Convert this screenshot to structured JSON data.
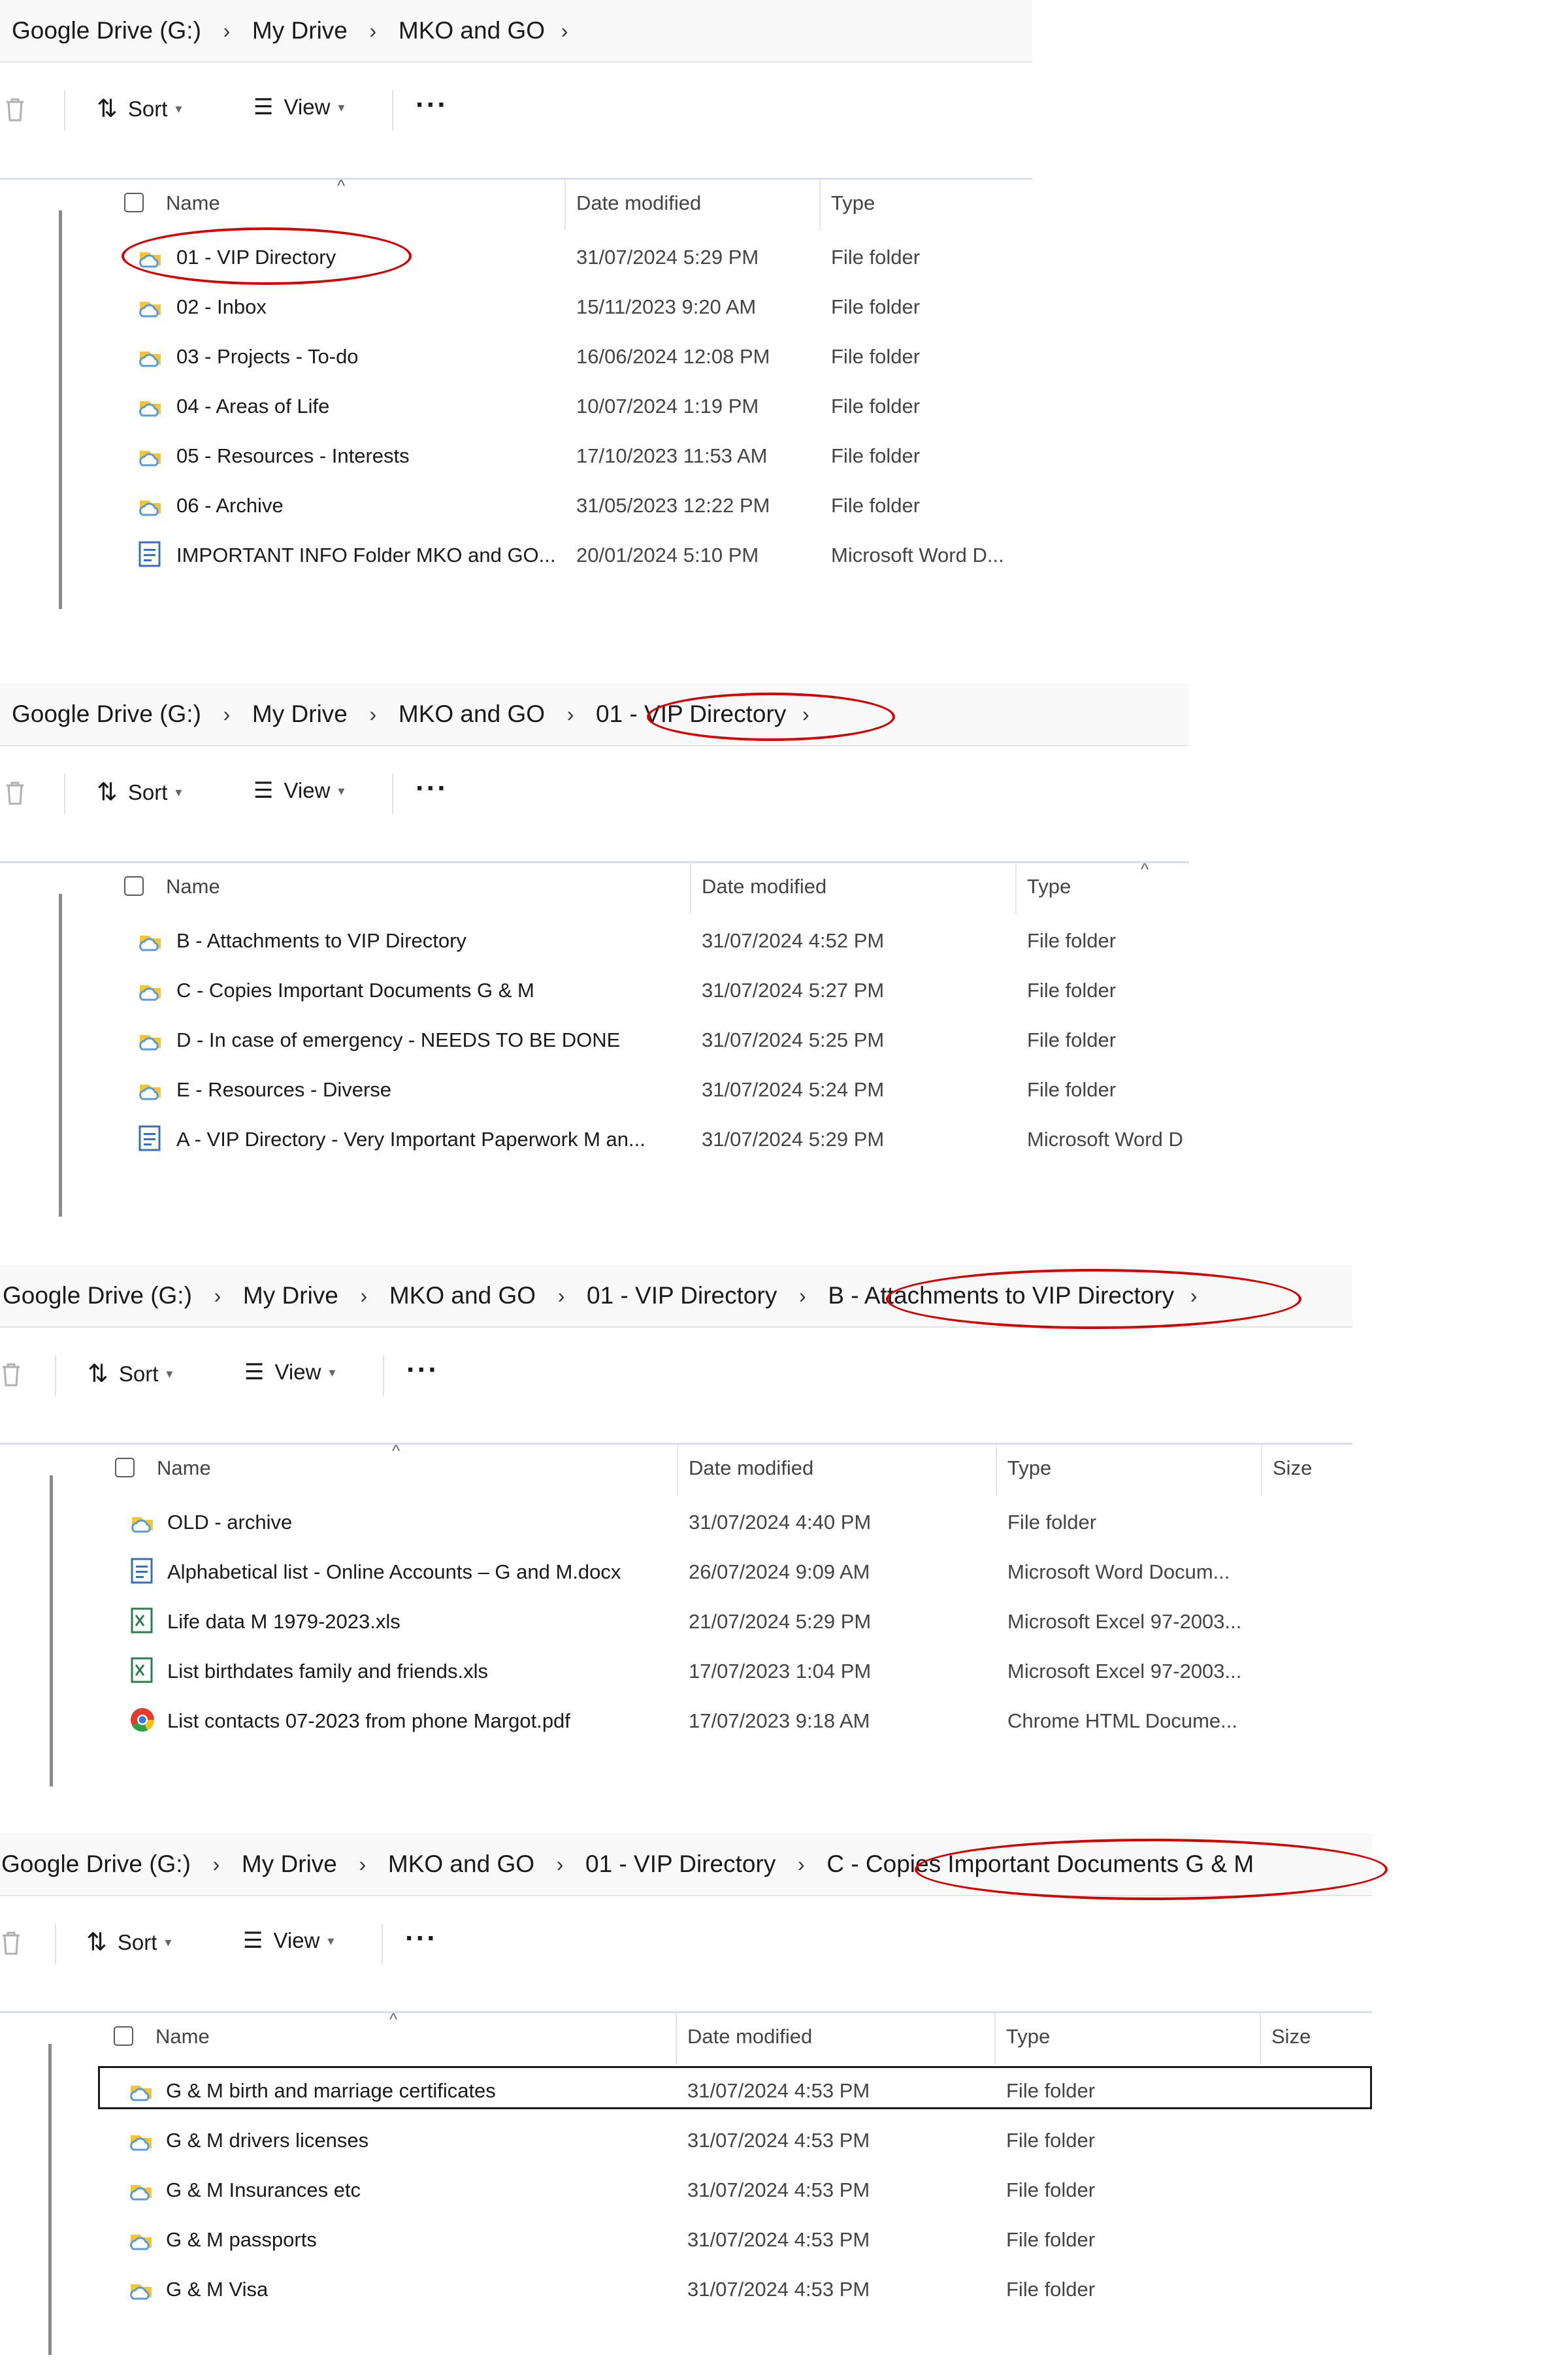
{
  "colors": {
    "highlight_ellipse": "#d40000",
    "breadcrumb_bg": "#f9f9f9",
    "folder": "#f2c53d",
    "cloud": "#5b9bd5"
  },
  "toolbar": {
    "sort": "Sort",
    "view": "View",
    "more": "···"
  },
  "columns": {
    "name": "Name",
    "date": "Date modified",
    "type": "Type",
    "size": "Size"
  },
  "panels": [
    {
      "breadcrumb": [
        "Google Drive (G:)",
        "My Drive",
        "MKO and GO"
      ],
      "rows": [
        {
          "icon": "folder-cloud-icon",
          "name": "01 - VIP Directory",
          "date": "31/07/2024 5:29 PM",
          "type": "File folder"
        },
        {
          "icon": "folder-cloud-icon",
          "name": "02 - Inbox",
          "date": "15/11/2023 9:20 AM",
          "type": "File folder"
        },
        {
          "icon": "folder-cloud-icon",
          "name": "03 - Projects - To-do",
          "date": "16/06/2024 12:08 PM",
          "type": "File folder"
        },
        {
          "icon": "folder-cloud-icon",
          "name": "04 - Areas of Life",
          "date": "10/07/2024 1:19 PM",
          "type": "File folder"
        },
        {
          "icon": "folder-cloud-icon",
          "name": "05 - Resources - Interests",
          "date": "17/10/2023 11:53 AM",
          "type": "File folder"
        },
        {
          "icon": "folder-cloud-icon",
          "name": "06 - Archive",
          "date": "31/05/2023 12:22 PM",
          "type": "File folder"
        },
        {
          "icon": "word-doc-icon",
          "name": "IMPORTANT INFO Folder MKO and GO...",
          "date": "20/01/2024 5:10 PM",
          "type": "Microsoft Word D..."
        }
      ]
    },
    {
      "breadcrumb": [
        "Google Drive (G:)",
        "My Drive",
        "MKO and GO",
        "01 - VIP Directory"
      ],
      "rows": [
        {
          "icon": "folder-cloud-icon",
          "name": "B - Attachments to VIP Directory",
          "date": "31/07/2024 4:52 PM",
          "type": "File folder"
        },
        {
          "icon": "folder-cloud-icon",
          "name": "C - Copies Important Documents G & M",
          "date": "31/07/2024 5:27 PM",
          "type": "File folder"
        },
        {
          "icon": "folder-cloud-icon",
          "name": "D - In case of emergency - NEEDS TO BE DONE",
          "date": "31/07/2024 5:25 PM",
          "type": "File folder"
        },
        {
          "icon": "folder-cloud-icon",
          "name": "E - Resources - Diverse",
          "date": "31/07/2024 5:24 PM",
          "type": "File folder"
        },
        {
          "icon": "word-doc-icon",
          "name": "A - VIP Directory - Very Important Paperwork  M an...",
          "date": "31/07/2024 5:29 PM",
          "type": "Microsoft Word D"
        }
      ]
    },
    {
      "breadcrumb": [
        "Google Drive (G:)",
        "My Drive",
        "MKO and GO",
        "01 - VIP Directory",
        "B - Attachments to VIP Directory"
      ],
      "rows": [
        {
          "icon": "folder-cloud-icon",
          "name": "OLD - archive",
          "date": "31/07/2024 4:40 PM",
          "type": "File folder"
        },
        {
          "icon": "word-doc-icon",
          "name": "Alphabetical list - Online Accounts – G and M.docx",
          "date": "26/07/2024 9:09 AM",
          "type": "Microsoft Word Docum..."
        },
        {
          "icon": "excel-icon",
          "name": "Life data M 1979-2023.xls",
          "date": "21/07/2024 5:29 PM",
          "type": "Microsoft Excel 97-2003..."
        },
        {
          "icon": "excel-icon",
          "name": "List birthdates family and friends.xls",
          "date": "17/07/2023 1:04 PM",
          "type": "Microsoft Excel 97-2003..."
        },
        {
          "icon": "chrome-icon",
          "name": "List contacts 07-2023 from phone Margot.pdf",
          "date": "17/07/2023 9:18 AM",
          "type": "Chrome HTML Docume..."
        }
      ]
    },
    {
      "breadcrumb": [
        "Google Drive (G:)",
        "My Drive",
        "MKO and GO",
        "01 - VIP Directory",
        "C - Copies Important Documents G & M"
      ],
      "rows": [
        {
          "icon": "folder-cloud-icon",
          "name": "G & M birth and marriage certificates",
          "date": "31/07/2024 4:53 PM",
          "type": "File folder"
        },
        {
          "icon": "folder-cloud-icon",
          "name": "G & M drivers licenses",
          "date": "31/07/2024 4:53 PM",
          "type": "File folder"
        },
        {
          "icon": "folder-cloud-icon",
          "name": "G & M Insurances etc",
          "date": "31/07/2024 4:53 PM",
          "type": "File folder"
        },
        {
          "icon": "folder-cloud-icon",
          "name": "G & M passports",
          "date": "31/07/2024 4:53 PM",
          "type": "File folder"
        },
        {
          "icon": "folder-cloud-icon",
          "name": "G & M Visa",
          "date": "31/07/2024 4:53 PM",
          "type": "File folder"
        }
      ]
    }
  ]
}
